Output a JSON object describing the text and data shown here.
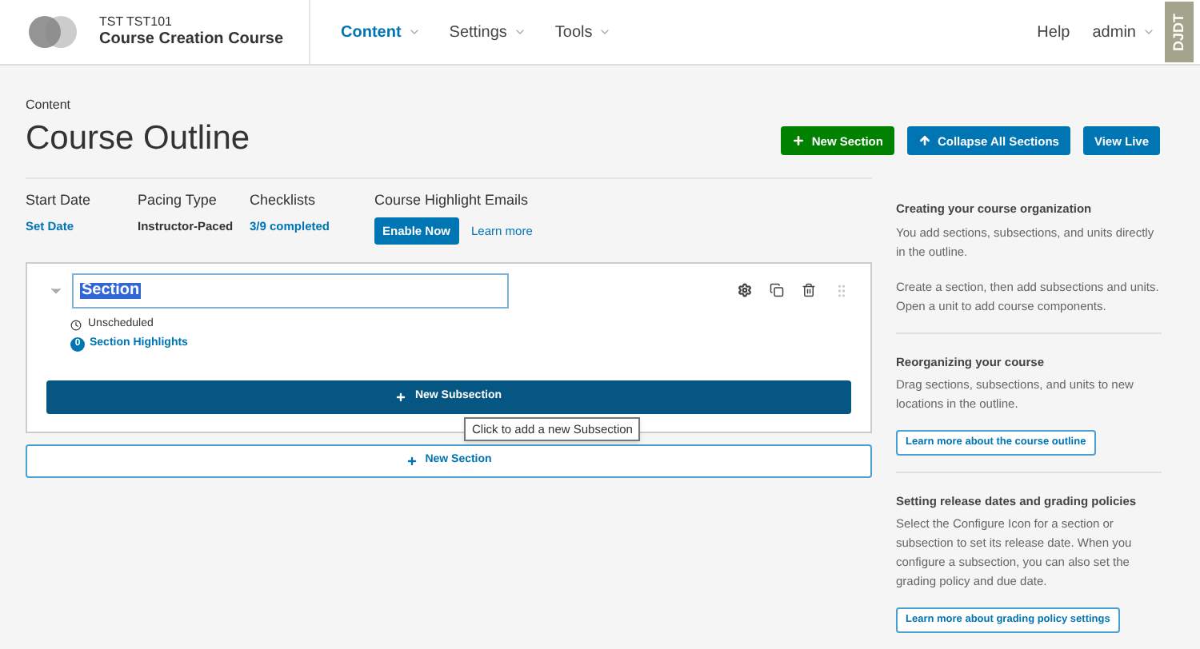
{
  "header": {
    "course_org": "TST TST101",
    "course_title": "Course Creation Course",
    "nav": [
      {
        "label": "Content",
        "selected": true
      },
      {
        "label": "Settings",
        "selected": false
      },
      {
        "label": "Tools",
        "selected": false
      }
    ],
    "help": "Help",
    "user": "admin"
  },
  "debug_toolbar": "DJDT",
  "page": {
    "breadcrumb": "Content",
    "title": "Course Outline",
    "actions": [
      {
        "label": "New Section",
        "kind": "add"
      },
      {
        "label": "Collapse All Sections",
        "kind": "collapse"
      },
      {
        "label": "View Live",
        "kind": "view"
      }
    ]
  },
  "course_info": [
    {
      "label": "Start Date",
      "value": "Set Date",
      "kind": "link"
    },
    {
      "label": "Pacing Type",
      "value": "Instructor-Paced",
      "kind": "text"
    },
    {
      "label": "Checklists",
      "value": "3/9 completed",
      "kind": "link"
    }
  ],
  "highlight_emails": {
    "label": "Course Highlight Emails",
    "button": "Enable Now",
    "link": "Learn more"
  },
  "section": {
    "name": "Section",
    "text_selected": true,
    "status": "Unscheduled",
    "highlights_count": "0",
    "highlights_label": "Section Highlights",
    "new_subsection": "New Subsection",
    "tooltip": "Click to add a new Subsection"
  },
  "new_section": "New Section",
  "sidebar": [
    {
      "title": "Creating your course organization",
      "paragraphs": [
        "You add sections, subsections, and units directly in the outline.",
        "Create a section, then add subsections and units. Open a unit to add course components."
      ]
    },
    {
      "title": "Reorganizing your course",
      "paragraphs": [
        "Drag sections, subsections, and units to new locations in the outline."
      ],
      "button": "Learn more about the course outline"
    },
    {
      "title": "Setting release dates and grading policies",
      "paragraphs": [
        "Select the Configure Icon for a section or subsection to set its release date. When you configure a subsection, you can also set the grading policy and due date."
      ],
      "button": "Learn more about grading policy settings"
    }
  ]
}
